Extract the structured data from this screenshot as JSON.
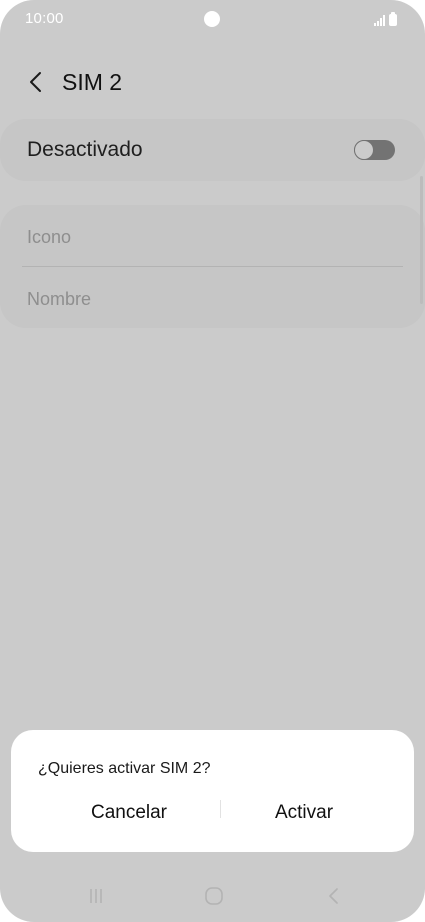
{
  "status_bar": {
    "time": "10:00",
    "icons": [
      "signal-icon",
      "battery-icon"
    ]
  },
  "header": {
    "back_icon": "chevron-left-icon",
    "title": "SIM 2"
  },
  "toggle": {
    "label": "Desactivado",
    "state": "off"
  },
  "fields": {
    "icon_label": "Icono",
    "name_label": "Nombre"
  },
  "dialog": {
    "message": "¿Quieres activar SIM 2?",
    "cancel_label": "Cancelar",
    "activate_label": "Activar"
  },
  "nav_bar": {
    "icons": [
      "recent-apps-icon",
      "home-icon",
      "back-icon"
    ]
  },
  "colors": {
    "background_dim": "#cbcbcb",
    "card": "#c6c6c6",
    "dialog": "#ffffff",
    "text_primary": "#111111",
    "text_secondary": "#8e8e8e"
  }
}
